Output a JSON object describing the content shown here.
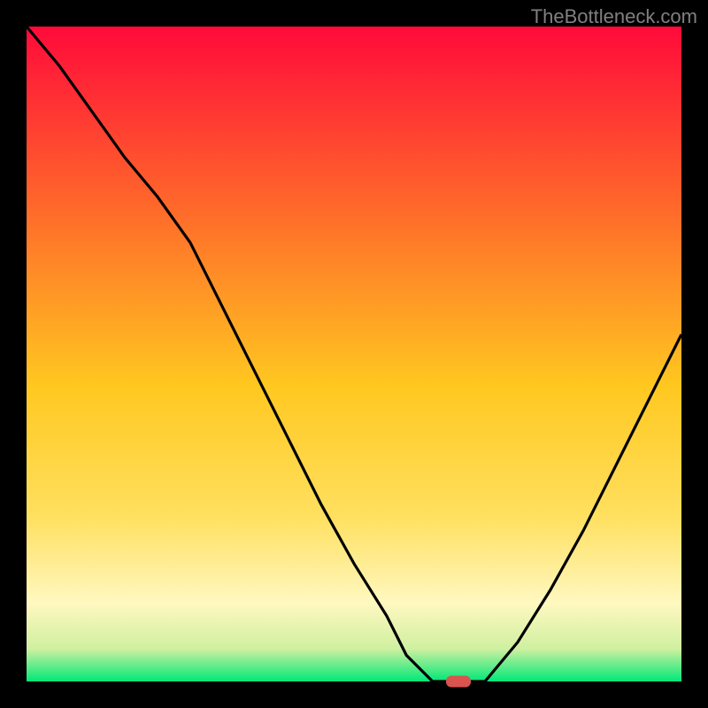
{
  "watermark": "TheBottleneck.com",
  "chart_data": {
    "type": "line",
    "title": "",
    "xlabel": "",
    "ylabel": "",
    "xlim": [
      0,
      100
    ],
    "ylim": [
      0,
      100
    ],
    "x": [
      0,
      5,
      10,
      15,
      20,
      25,
      30,
      35,
      40,
      45,
      50,
      55,
      58,
      62,
      66,
      70,
      75,
      80,
      85,
      90,
      95,
      100
    ],
    "y": [
      100,
      94,
      87,
      80,
      74,
      67,
      57,
      47,
      37,
      27,
      18,
      10,
      4,
      0,
      0,
      0,
      6,
      14,
      23,
      33,
      43,
      53
    ],
    "marker": {
      "x": 66,
      "y": 0,
      "color": "#d9534f"
    },
    "gradient_colors": {
      "top": "#ff0a3a",
      "upper_mid": "#ff6a2a",
      "mid": "#ffc820",
      "lower_mid": "#ffe060",
      "yellow_pale": "#fff8c0",
      "near_bottom": "#d0f0a0",
      "bottom": "#00e878"
    }
  }
}
